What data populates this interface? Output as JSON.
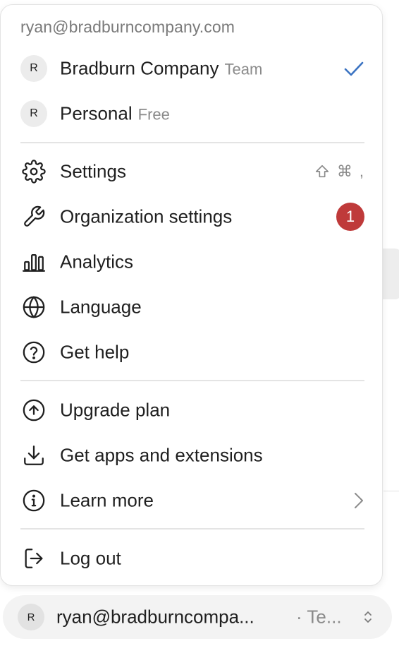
{
  "account_email": "ryan@bradburncompany.com",
  "workspaces": [
    {
      "initial": "R",
      "name": "Bradburn Company",
      "plan": "Team",
      "selected": true
    },
    {
      "initial": "R",
      "name": "Personal",
      "plan": "Free",
      "selected": false
    }
  ],
  "menu": {
    "settings": {
      "label": "Settings",
      "icon": "gear-icon",
      "shortcut": [
        ",",
        "⌘"
      ]
    },
    "organization_settings": {
      "label": "Organization settings",
      "icon": "wrench-icon",
      "badge": "1"
    },
    "analytics": {
      "label": "Analytics",
      "icon": "bar-chart-icon"
    },
    "language": {
      "label": "Language",
      "icon": "globe-icon"
    },
    "get_help": {
      "label": "Get help",
      "icon": "help-circle-icon"
    },
    "upgrade_plan": {
      "label": "Upgrade plan",
      "icon": "arrow-up-circle-icon"
    },
    "get_apps": {
      "label": "Get apps and extensions",
      "icon": "download-icon"
    },
    "learn_more": {
      "label": "Learn more",
      "icon": "info-circle-icon"
    },
    "log_out": {
      "label": "Log out",
      "icon": "logout-icon"
    }
  },
  "account_bar": {
    "initial": "R",
    "email": "ryan@bradburncompa...",
    "plan": "· Te..."
  },
  "colors": {
    "accent": "#3b73c2",
    "badge": "#bf3a3a",
    "muted_text": "#8a8a8a",
    "divider": "#e4e4e4"
  }
}
